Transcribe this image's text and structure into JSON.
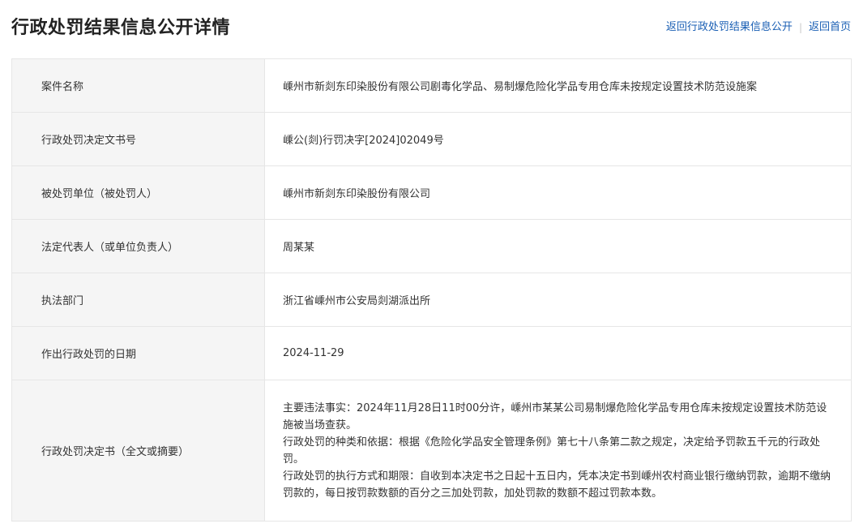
{
  "header": {
    "title": "行政处罚结果信息公开详情",
    "link_back_list": "返回行政处罚结果信息公开",
    "separator": "|",
    "link_home": "返回首页"
  },
  "rows": [
    {
      "label": "案件名称",
      "value": "嵊州市新剡东印染股份有限公司剧毒化学品、易制爆危险化学品专用仓库未按规定设置技术防范设施案"
    },
    {
      "label": "行政处罚决定文书号",
      "value": "嵊公(剡)行罚决字[2024]02049号"
    },
    {
      "label": "被处罚单位（被处罚人）",
      "value": "嵊州市新剡东印染股份有限公司"
    },
    {
      "label": "法定代表人（或单位负责人）",
      "value": "周某某"
    },
    {
      "label": "执法部门",
      "value": "浙江省嵊州市公安局剡湖派出所"
    },
    {
      "label": "作出行政处罚的日期",
      "value": "2024-11-29"
    }
  ],
  "decision": {
    "label": "行政处罚决定书（全文或摘要）",
    "paragraphs": [
      "主要违法事实：2024年11月28日11时00分许，嵊州市某某公司易制爆危险化学品专用仓库未按规定设置技术防范设施被当场查获。",
      "行政处罚的种类和依据：根据《危险化学品安全管理条例》第七十八条第二款之规定，决定给予罚款五千元的行政处罚。",
      "行政处罚的执行方式和期限：自收到本决定书之日起十五日内，凭本决定书到嵊州农村商业银行缴纳罚款，逾期不缴纳罚款的，每日按罚款数额的百分之三加处罚款，加处罚款的数额不超过罚款本数。"
    ]
  }
}
